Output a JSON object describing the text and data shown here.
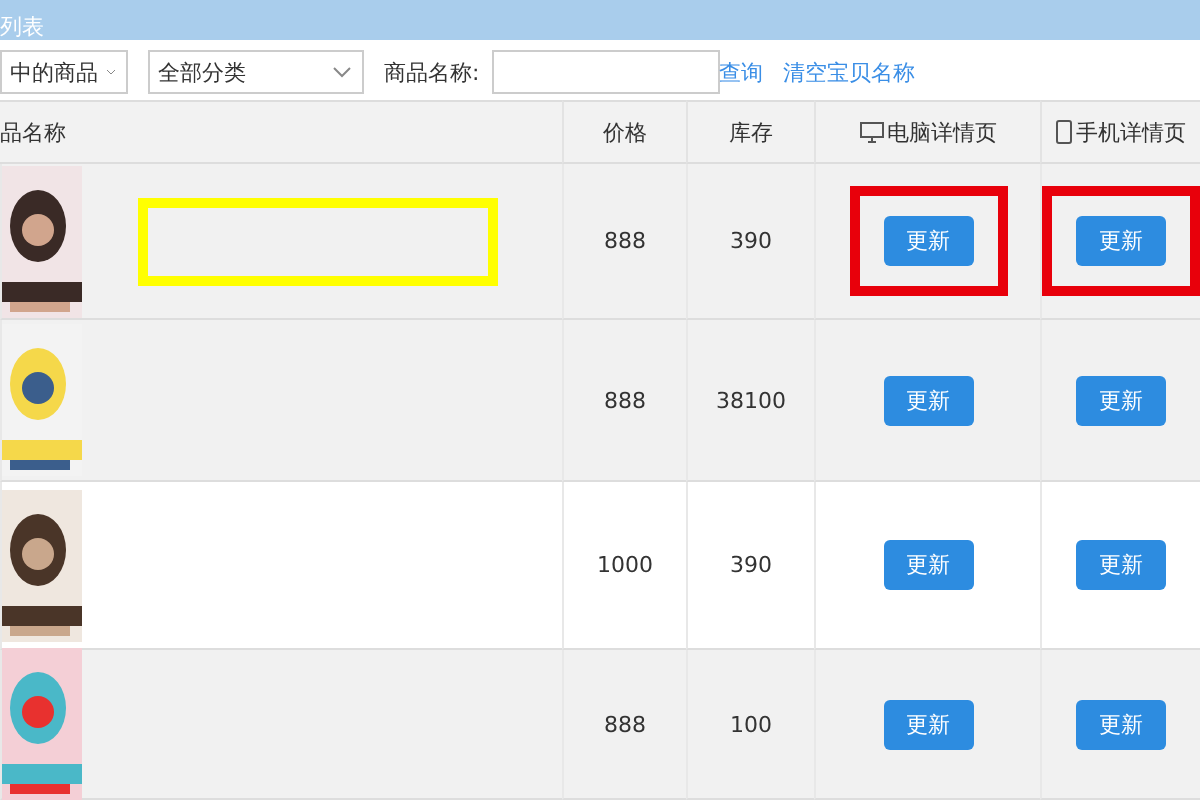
{
  "panel": {
    "title": "列表"
  },
  "filters": {
    "scope": "中的商品",
    "category": "全部分类",
    "name_label": "商品名称:",
    "search_link": "查询",
    "clear_link": "清空宝贝名称"
  },
  "table": {
    "columns": [
      {
        "label": "品名称"
      },
      {
        "label": "价格"
      },
      {
        "label": "库存"
      },
      {
        "label": "电脑详情页"
      },
      {
        "label": "手机详情页"
      }
    ],
    "rows": [
      {
        "price": "888",
        "stock": "390",
        "pc_button": "更新",
        "mobile_button": "更新",
        "highlighted": true,
        "shaded": true
      },
      {
        "price": "888",
        "stock": "38100",
        "pc_button": "更新",
        "mobile_button": "更新",
        "highlighted": false,
        "shaded": true
      },
      {
        "price": "1000",
        "stock": "390",
        "pc_button": "更新",
        "mobile_button": "更新",
        "highlighted": false,
        "shaded": false
      },
      {
        "price": "888",
        "stock": "100",
        "pc_button": "更新",
        "mobile_button": "更新",
        "highlighted": false,
        "shaded": true
      }
    ]
  }
}
